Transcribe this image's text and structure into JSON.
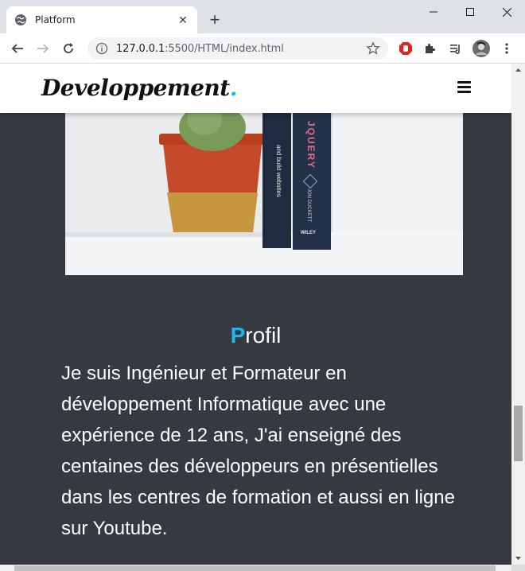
{
  "browser": {
    "tab_title": "Platform",
    "new_tab_label": "+",
    "tab_close_label": "✕",
    "url_host": "127.0.0.1",
    "url_rest": ":5500/HTML/index.html"
  },
  "page": {
    "brand_text": "Developpement",
    "brand_dot": ".",
    "profil_first_letter": "P",
    "profil_rest": "rofil",
    "bio": "Je suis Ingénieur et Formateur en développement Informatique avec une expérience de 12 ans, J'ai enseigné des centaines des développeurs en présentielles dans les centres de formation et aussi en ligne sur Youtube.",
    "accent_color": "#1fb6f0",
    "background_color": "#343a40",
    "photo_book_text_1": "and build websites",
    "photo_book_text_2": "JQUERY",
    "photo_book_publisher": "WILEY",
    "photo_book_author": "JON DUCKETT"
  }
}
